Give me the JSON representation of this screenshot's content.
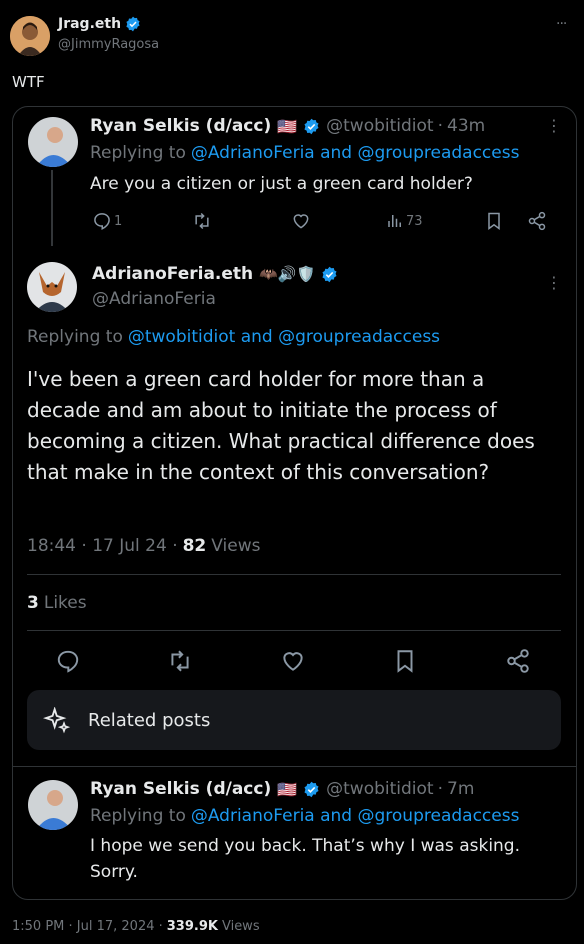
{
  "main_post": {
    "author_name": "Jrag.eth",
    "author_handle": "@JimmyRagosa",
    "text": "WTF",
    "more_label": "···"
  },
  "reply1": {
    "author_name": "Ryan Selkis (d/acc)",
    "flag": "🇺🇸",
    "handle": "@twobitidiot",
    "sep": "·",
    "time": "43m",
    "replying_prefix": "Replying to",
    "replying_to": "@AdrianoFeria and @groupreadaccess",
    "text": "Are you a citizen or just a green card holder?",
    "reply_count": "1",
    "view_count": "73"
  },
  "focus": {
    "author_name": "AdrianoFeria.eth",
    "emojis": "🦇🔊🛡️",
    "handle": "@AdrianoFeria",
    "replying_prefix": "Replying to",
    "replying_to": "@twobitidiot and @groupreadaccess",
    "text": "I've been a green card holder for more than a decade and am about to initiate the process of becoming a citizen. What practical difference does that make in the context of this conversation?",
    "time": "18:44 · 17 Jul 24 ·",
    "views_count": "82",
    "views_label": "Views",
    "likes_count": "3",
    "likes_label": "Likes"
  },
  "related_posts_label": "Related posts",
  "reply2": {
    "author_name": "Ryan Selkis (d/acc)",
    "flag": "🇺🇸",
    "handle": "@twobitidiot",
    "sep": "·",
    "time": "7m",
    "replying_prefix": "Replying to",
    "replying_to": "@AdrianoFeria and @groupreadaccess",
    "text_line1": "I hope we send you back. That’s why I was asking.",
    "text_line2": "Sorry."
  },
  "footer": {
    "time": "1:50 PM · Jul 17, 2024 ·",
    "views_count": "339.9K",
    "views_label": "Views"
  },
  "colors": {
    "accent": "#1d9bf0",
    "background": "#000000",
    "text": "#e7e9ea",
    "muted": "#71767b",
    "border": "#2f3336"
  }
}
